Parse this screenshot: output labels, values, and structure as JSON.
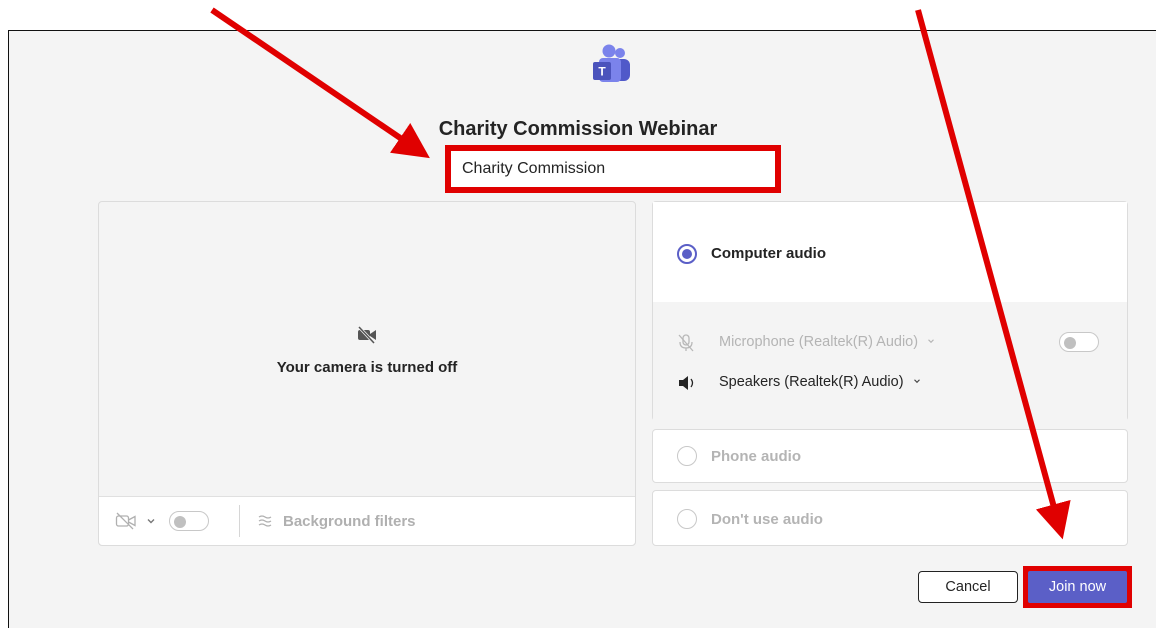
{
  "meeting": {
    "title": "Charity Commission Webinar"
  },
  "name_input": {
    "value": "Charity Commission"
  },
  "video": {
    "camera_off_text": "Your camera is turned off",
    "background_filters_label": "Background filters"
  },
  "audio": {
    "computer_audio_label": "Computer audio",
    "microphone_label": "Microphone (Realtek(R) Audio)",
    "speakers_label": "Speakers (Realtek(R) Audio)",
    "phone_audio_label": "Phone audio",
    "no_audio_label": "Don't use audio"
  },
  "actions": {
    "cancel_label": "Cancel",
    "join_label": "Join now"
  },
  "colors": {
    "accent": "#5b5fc7",
    "annotation_red": "#e00000"
  },
  "icons": [
    "teams-logo-icon",
    "camera-off-icon",
    "camera-toggle-icon",
    "chevron-down-icon",
    "background-filters-icon",
    "mic-muted-icon",
    "speaker-icon",
    "red-arrow-annotation"
  ]
}
